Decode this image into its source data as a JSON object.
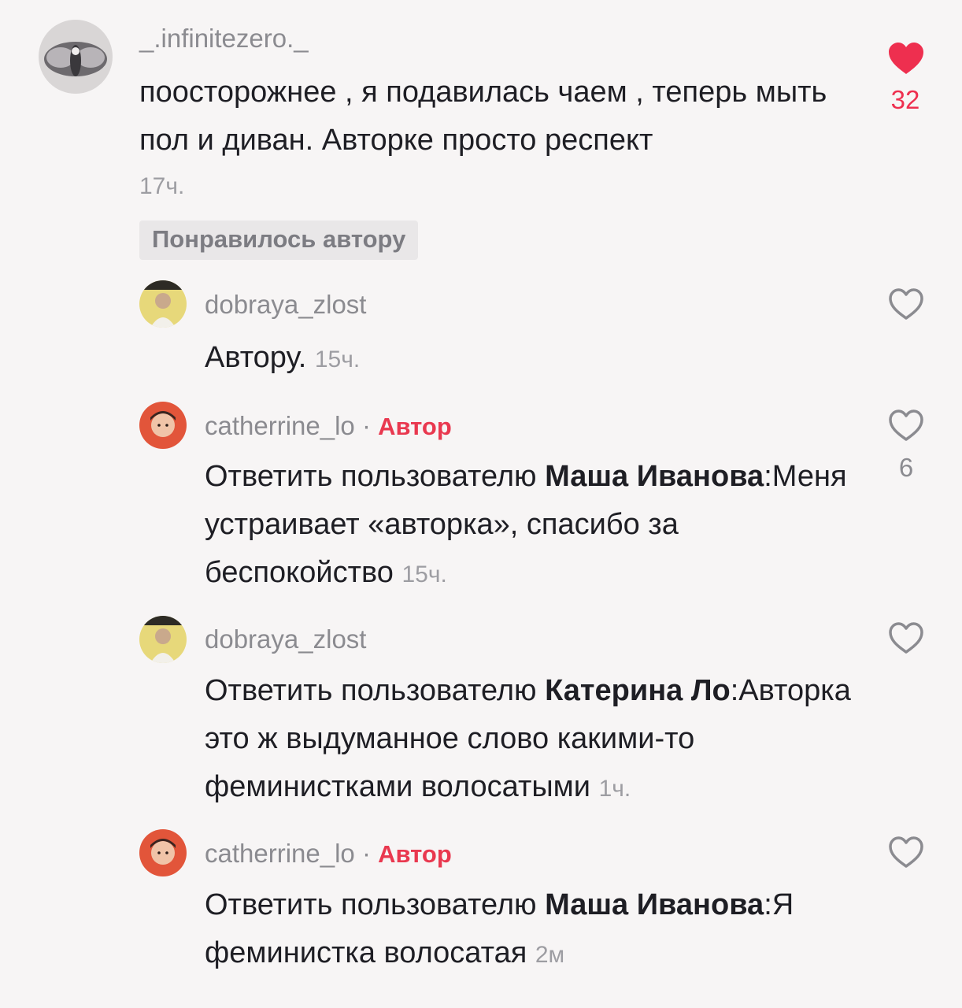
{
  "comments": [
    {
      "username": "_.infinitezero._",
      "text": "поосторожнее , я подавилась чаем , теперь мыть пол и диван. Авторке просто респект",
      "time": "17ч.",
      "likes": "32",
      "liked": true,
      "badge": "Понравилось автору"
    },
    {
      "username": "dobraya_zlost",
      "text": "Автору.",
      "time": "15ч.",
      "likes": ""
    },
    {
      "username": "catherrine_lo",
      "dot": "·",
      "author_label": "Автор",
      "reply_prefix": "Ответить пользователю ",
      "reply_target": "Маша Иванова",
      "text": ":Меня устраивает «авторка», спасибо за беспокойство",
      "time": "15ч.",
      "likes": "6"
    },
    {
      "username": "dobraya_zlost",
      "reply_prefix": "Ответить пользователю ",
      "reply_target": "Катерина Ло",
      "text": ":Авторка это ж выдуманное слово какими-то феминистками волосатыми",
      "time": "1ч.",
      "likes": ""
    },
    {
      "username": "catherrine_lo",
      "dot": "·",
      "author_label": "Автор",
      "reply_prefix": "Ответить пользователю ",
      "reply_target": "Маша Иванова",
      "text": ":Я феминистка волосатая",
      "time": "2м",
      "likes": ""
    }
  ],
  "colors": {
    "liked_heart": "#ee2f4f",
    "author_accent": "#e9384f",
    "background": "#f7f5f5"
  },
  "icons": {
    "heart_filled": "heart-filled-icon",
    "heart_outline": "heart-outline-icon"
  }
}
